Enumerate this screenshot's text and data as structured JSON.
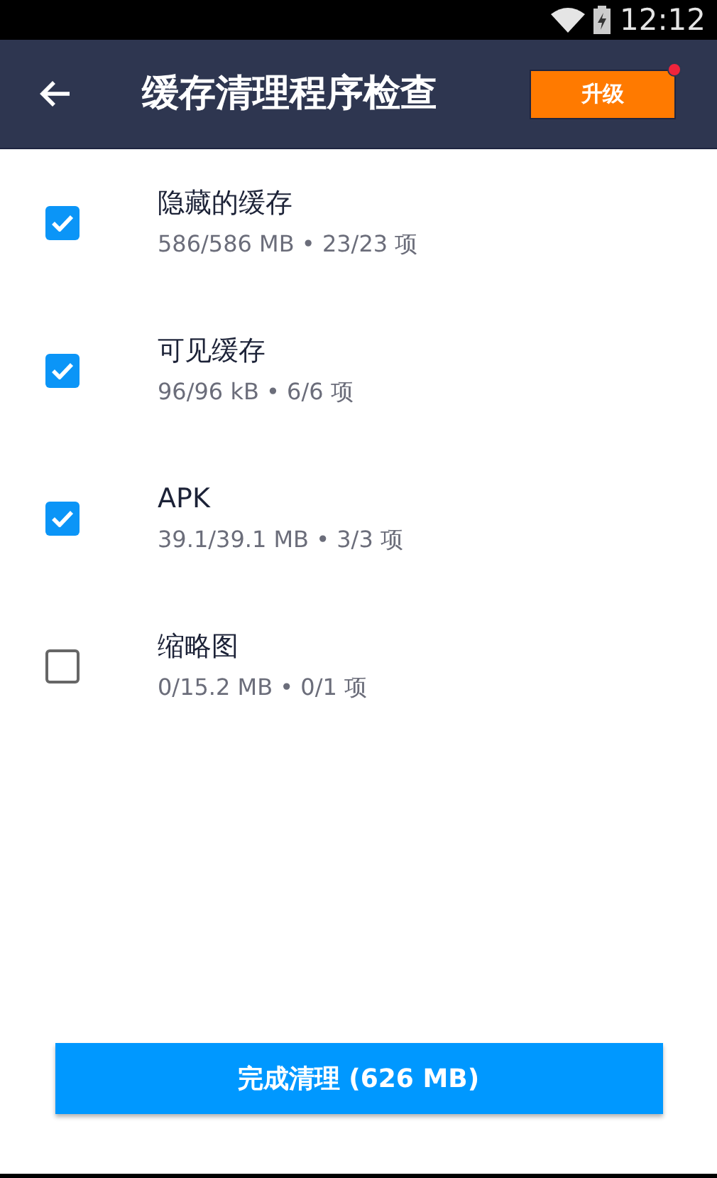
{
  "status_bar": {
    "time": "12:12"
  },
  "app_bar": {
    "title": "缓存清理程序检查",
    "upgrade_button": "升级"
  },
  "items": [
    {
      "title": "隐藏的缓存",
      "detail": "586/586 MB • 23/23 项",
      "checked": true
    },
    {
      "title": "可见缓存",
      "detail": "96/96 kB • 6/6 项",
      "checked": true
    },
    {
      "title": "APK",
      "detail": "39.1/39.1 MB • 3/3 项",
      "checked": true
    },
    {
      "title": "缩略图",
      "detail": "0/15.2 MB • 0/1 项",
      "checked": false
    }
  ],
  "finish_button": "完成清理 (626 MB)"
}
